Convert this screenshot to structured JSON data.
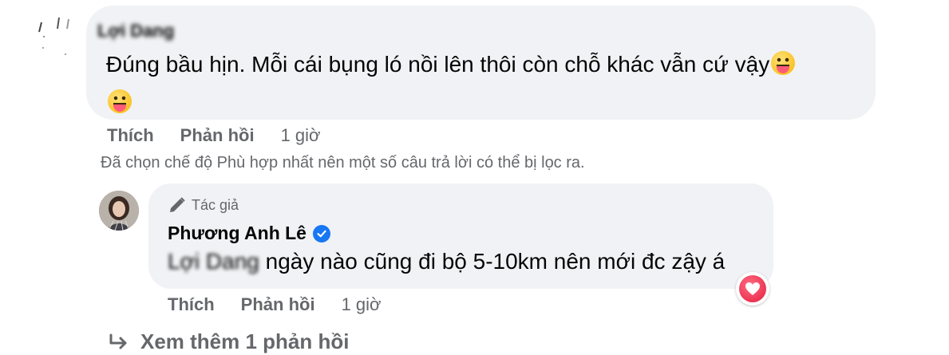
{
  "comment": {
    "author": "Lợi Dang",
    "text": "Đúng bầu hịn. Mỗi cái bụng ló nồi lên thôi còn chỗ khác vẫn cứ vậy",
    "like_label": "Thích",
    "reply_label": "Phản hồi",
    "time": "1 giờ"
  },
  "filter_notice": "Đã chọn chế độ Phù hợp nhất nên một số câu trả lời có thể bị lọc ra.",
  "reply": {
    "badge_label": "Tác giả",
    "author": "Phương Anh Lê",
    "mention": "Lợi Dang",
    "text": " ngày nào cũng đi bộ 5-10km nên mới đc zậy á",
    "like_label": "Thích",
    "reply_label": "Phản hồi",
    "time": "1 giờ",
    "reaction": "heart-icon"
  },
  "more_replies_label": "Xem thêm 1 phản hồi",
  "colors": {
    "bubble": "#f0f2f5",
    "secondary_text": "#65676b",
    "verified": "#1877f2",
    "heart": "#e41e3f"
  }
}
